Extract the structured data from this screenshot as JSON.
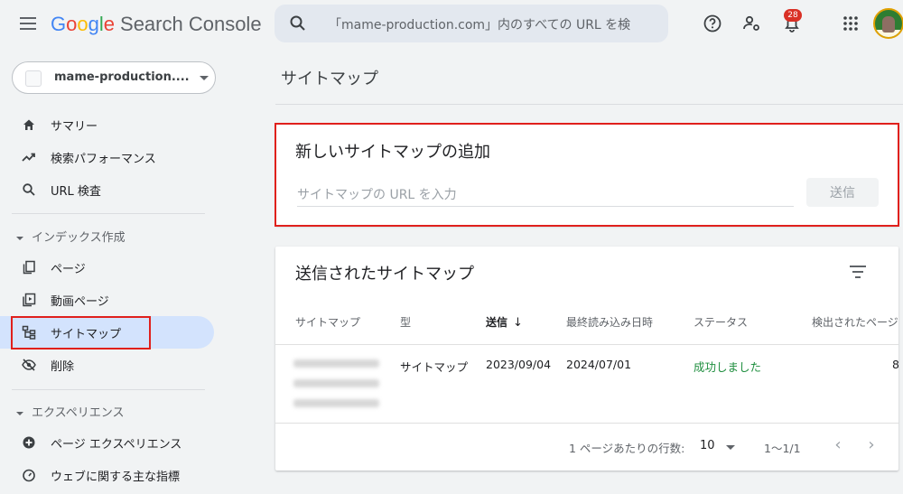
{
  "app": {
    "logo": {
      "g1": "G",
      "o1": "o",
      "o2": "o",
      "g2": "g",
      "l": "l",
      "e": "e"
    },
    "product_name": "Search Console"
  },
  "search": {
    "placeholder": "「mame-production.com」内のすべての URL を検"
  },
  "notifications": {
    "count": "28"
  },
  "property": {
    "label": "mame-production...."
  },
  "sidebar": {
    "items": [
      {
        "label": "サマリー",
        "icon": "home-icon"
      },
      {
        "label": "検索パフォーマンス",
        "icon": "trending-up-icon"
      },
      {
        "label": "URL 検査",
        "icon": "search-icon"
      }
    ],
    "index_section": {
      "label": "インデックス作成",
      "items": [
        {
          "label": "ページ",
          "icon": "pages-icon"
        },
        {
          "label": "動画ページ",
          "icon": "video-page-icon"
        },
        {
          "label": "サイトマップ",
          "icon": "sitemap-icon"
        },
        {
          "label": "削除",
          "icon": "removals-icon"
        }
      ]
    },
    "experience_section": {
      "label": "エクスペリエンス",
      "items": [
        {
          "label": "ページ エクスペリエンス",
          "icon": "page-experience-icon"
        },
        {
          "label": "ウェブに関する主な指標",
          "icon": "speed-gauge-icon"
        }
      ]
    }
  },
  "main": {
    "page_title": "サイトマップ",
    "add_card": {
      "title": "新しいサイトマップの追加",
      "input_placeholder": "サイトマップの URL を入力",
      "submit_label": "送信"
    },
    "list_card": {
      "title": "送信されたサイトマップ",
      "columns": [
        "サイトマップ",
        "型",
        "送信",
        "最終読み込み日時",
        "ステータス",
        "検出されたページ数"
      ],
      "sort_arrow": "↓",
      "rows": [
        {
          "type": "サイトマップ",
          "submitted": "2023/09/04",
          "last_read": "2024/07/01",
          "status": "成功しました",
          "discovered": "8"
        }
      ],
      "footer": {
        "rows_per_page_label": "1 ページあたりの行数:",
        "rows_per_page_value": "10",
        "range": "1〜1/1",
        "prev": "‹",
        "next": "›"
      }
    }
  },
  "colors": {
    "accent": "#1a73e8",
    "active_nav": "#d3e3fd",
    "success": "#1e8e3e",
    "highlight_box": "#e0201c",
    "badge": "#d93025"
  }
}
